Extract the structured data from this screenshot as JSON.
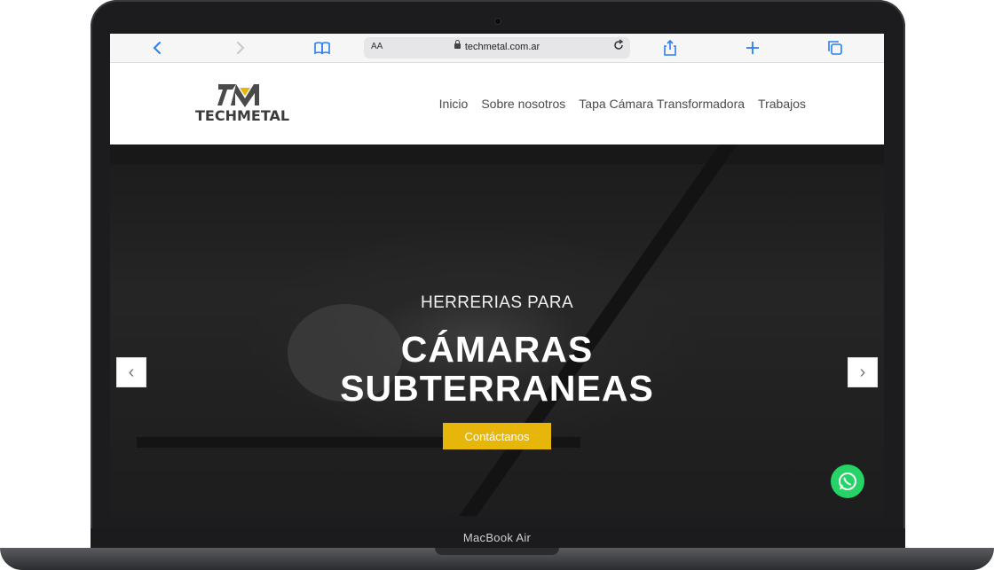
{
  "device": {
    "model_label": "MacBook Air"
  },
  "browser": {
    "url": "techmetal.com.ar",
    "text_size_button": "AA",
    "icons": {
      "back": "chevron-left-icon",
      "forward": "chevron-right-icon",
      "bookmarks": "book-icon",
      "reload": "reload-icon",
      "share": "share-icon",
      "new_tab": "plus-icon",
      "tabs": "tabs-icon"
    }
  },
  "site": {
    "logo_text": "TECHMETAL",
    "nav": [
      {
        "label": "Inicio"
      },
      {
        "label": "Sobre nosotros"
      },
      {
        "label": "Tapa Cámara Transformadora"
      },
      {
        "label": "Trabajos"
      }
    ],
    "hero": {
      "pre_title": "HERRERIAS PARA",
      "title_line1": "CÁMARAS",
      "title_line2": "SUBTERRANEAS",
      "cta_label": "Contáctanos",
      "prev_arrow": "‹",
      "next_arrow": "›"
    },
    "colors": {
      "accent": "#e6b60b",
      "whatsapp": "#25d366"
    }
  }
}
